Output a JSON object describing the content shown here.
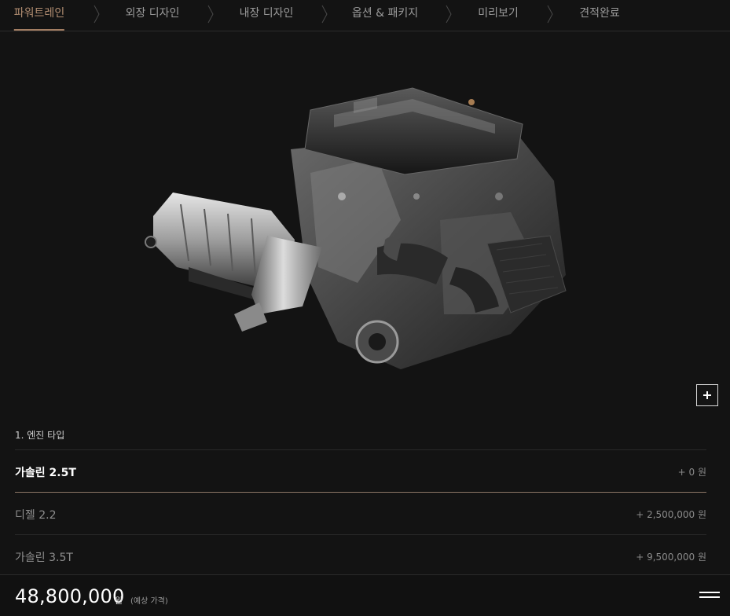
{
  "steps": [
    {
      "label": "파워트레인",
      "active": true
    },
    {
      "label": "외장 디자인"
    },
    {
      "label": "내장 디자인"
    },
    {
      "label": "옵션 & 패키지"
    },
    {
      "label": "미리보기"
    },
    {
      "label": "견적완료"
    }
  ],
  "section": {
    "title": "1. 엔진 타입"
  },
  "options": [
    {
      "name": "가솔린 2.5T",
      "price": "+ 0 원",
      "selected": true
    },
    {
      "name": "디젤 2.2",
      "price": "+ 2,500,000 원"
    },
    {
      "name": "가솔린 3.5T",
      "price": "+ 9,500,000 원"
    }
  ],
  "footer": {
    "total": "48,800,000",
    "unit": "원",
    "note": "(예상 가격)"
  },
  "colors": {
    "accent": "#b38e72",
    "background": "#131313"
  },
  "icons": {
    "zoom": "plus-icon",
    "menu": "hamburger-icon",
    "separator": "chevron-right-icon"
  }
}
